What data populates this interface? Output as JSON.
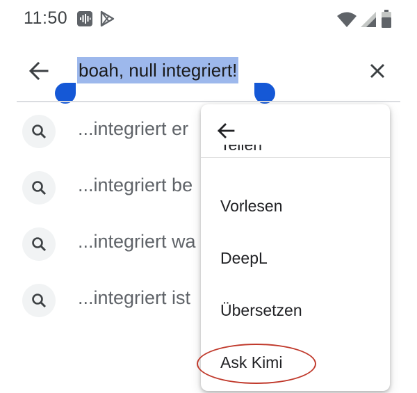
{
  "status_bar": {
    "time": "11:50",
    "notification_icons": [
      "voice-memo-icon",
      "play-store-icon"
    ],
    "system_icons": [
      "wifi-icon",
      "cell-signal-icon",
      "battery-icon"
    ]
  },
  "search": {
    "query": "boah, null integriert!",
    "selection_color": "#9db8ec",
    "handle_color": "#1558d6"
  },
  "suggestions": [
    {
      "text": "...integriert er"
    },
    {
      "text": "...integriert be"
    },
    {
      "text": "...integriert wa"
    },
    {
      "text": "...integriert ist"
    }
  ],
  "context_menu": {
    "clipped_item": "Teilen",
    "items": [
      {
        "label": "Vorlesen"
      },
      {
        "label": "DeepL"
      },
      {
        "label": "Übersetzen"
      },
      {
        "label": "Ask Kimi",
        "highlighted": true
      }
    ],
    "highlight_color": "#c0392b"
  }
}
